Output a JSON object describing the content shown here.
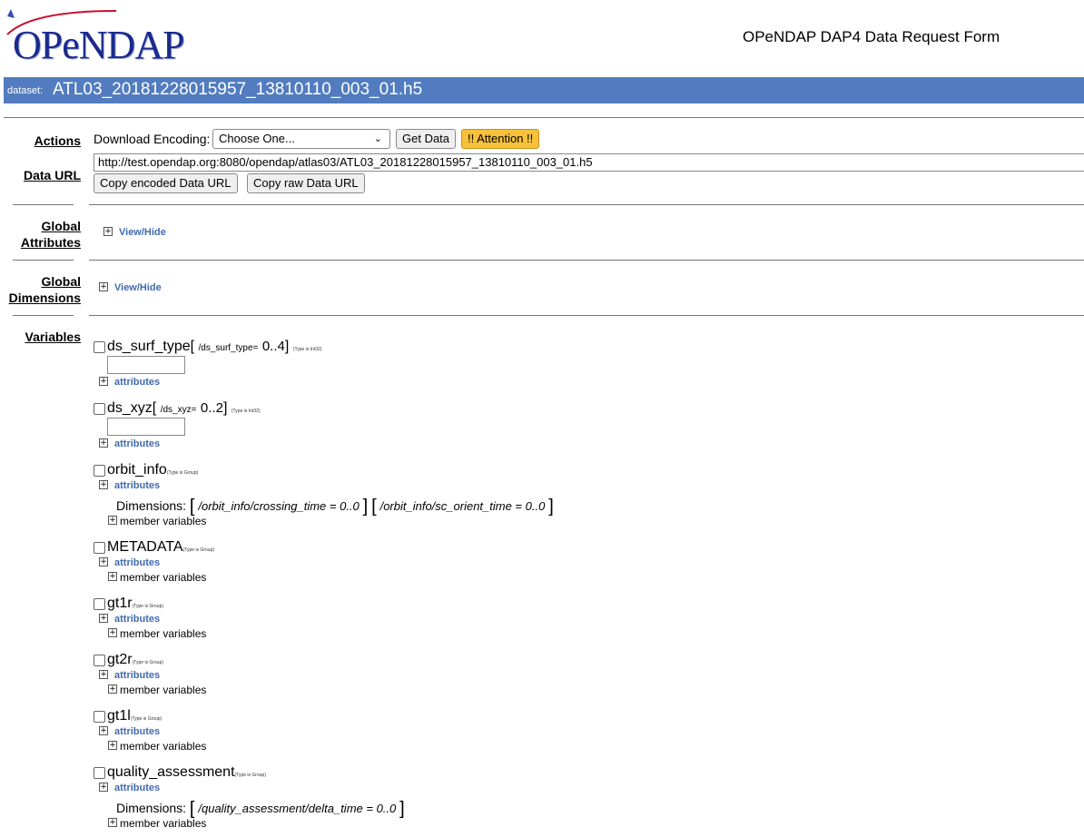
{
  "header": {
    "logo_text": "OPeNDAP",
    "form_title": "OPeNDAP DAP4 Data Request Form",
    "dataset_label": "dataset:",
    "dataset_name": "ATL03_20181228015957_13810110_003_01.h5",
    "accent_color": "#527cbf"
  },
  "actions": {
    "label": "Actions",
    "download_encoding_label": "Download Encoding:",
    "encoding_selected": "Choose One...",
    "get_data": "Get Data",
    "attention": "!! Attention !!"
  },
  "data_url": {
    "label": "Data URL",
    "value": "http://test.opendap.org:8080/opendap/atlas03/ATL03_20181228015957_13810110_003_01.h5",
    "copy_encoded": "Copy encoded Data URL",
    "copy_raw": "Copy raw Data URL"
  },
  "global_attributes": {
    "label_line1": "Global",
    "label_line2": "Attributes",
    "toggle": "View/Hide"
  },
  "global_dimensions": {
    "label_line1": "Global",
    "label_line2": "Dimensions",
    "toggle": "View/Hide"
  },
  "variables": {
    "label": "Variables",
    "attributes_link": "attributes",
    "member_variables": "member variables",
    "dimensions_label": "Dimensions:",
    "items": [
      {
        "name": "ds_surf_type",
        "dim_name": "/ds_surf_type=",
        "dim_range": "0..4",
        "type": "(Type is Int32)"
      },
      {
        "name": "ds_xyz",
        "dim_name": "/ds_xyz=",
        "dim_range": "0..2",
        "type": "(Type is Int32)"
      },
      {
        "name": "orbit_info",
        "type": "(Type is Group)",
        "dim1": "/orbit_info/crossing_time = ",
        "dim1_range": "0..0",
        "dim2": "/orbit_info/sc_orient_time = ",
        "dim2_range": "0..0"
      },
      {
        "name": "METADATA",
        "type": "(Type is Group)"
      },
      {
        "name": "gt1r",
        "type": "(Type is Group)"
      },
      {
        "name": "gt2r",
        "type": "(Type is Group)"
      },
      {
        "name": "gt1l",
        "type": "(Type is Group)"
      },
      {
        "name": "quality_assessment",
        "type": "(Type is Group)",
        "dim1": "/quality_assessment/delta_time = ",
        "dim1_range": "0..0"
      }
    ]
  }
}
